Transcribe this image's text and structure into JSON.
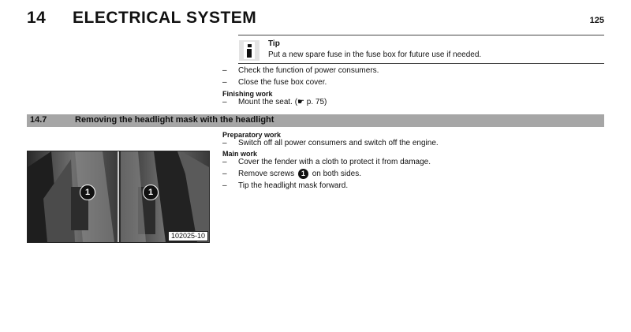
{
  "header": {
    "chapter_number": "14",
    "chapter_title": "ELECTRICAL SYSTEM",
    "page_number": "125"
  },
  "tip": {
    "icon": "info-icon",
    "label": "Tip",
    "text": "Put a new spare fuse in the fuse box for future use if needed."
  },
  "steps_top": [
    "Check the function of power consumers.",
    "Close the fuse box cover."
  ],
  "finishing": {
    "heading": "Finishing work",
    "dash": "–",
    "text": "Mount the seat. (☛ p. 75)"
  },
  "section": {
    "number": "14.7",
    "title": "Removing the headlight mask with the headlight"
  },
  "preparatory": {
    "heading": "Preparatory work",
    "text": "Switch off all power consumers and switch off the engine."
  },
  "main_work": {
    "heading": "Main work",
    "step1": "Cover the fender with a cloth to protect it from damage.",
    "step2_before": "Remove screws",
    "step2_badge": "1",
    "step2_after": "on both sides.",
    "step3": "Tip the headlight mask forward."
  },
  "figure": {
    "id": "102025-10",
    "callout_left": "1",
    "callout_right": "1"
  },
  "dash": "–"
}
